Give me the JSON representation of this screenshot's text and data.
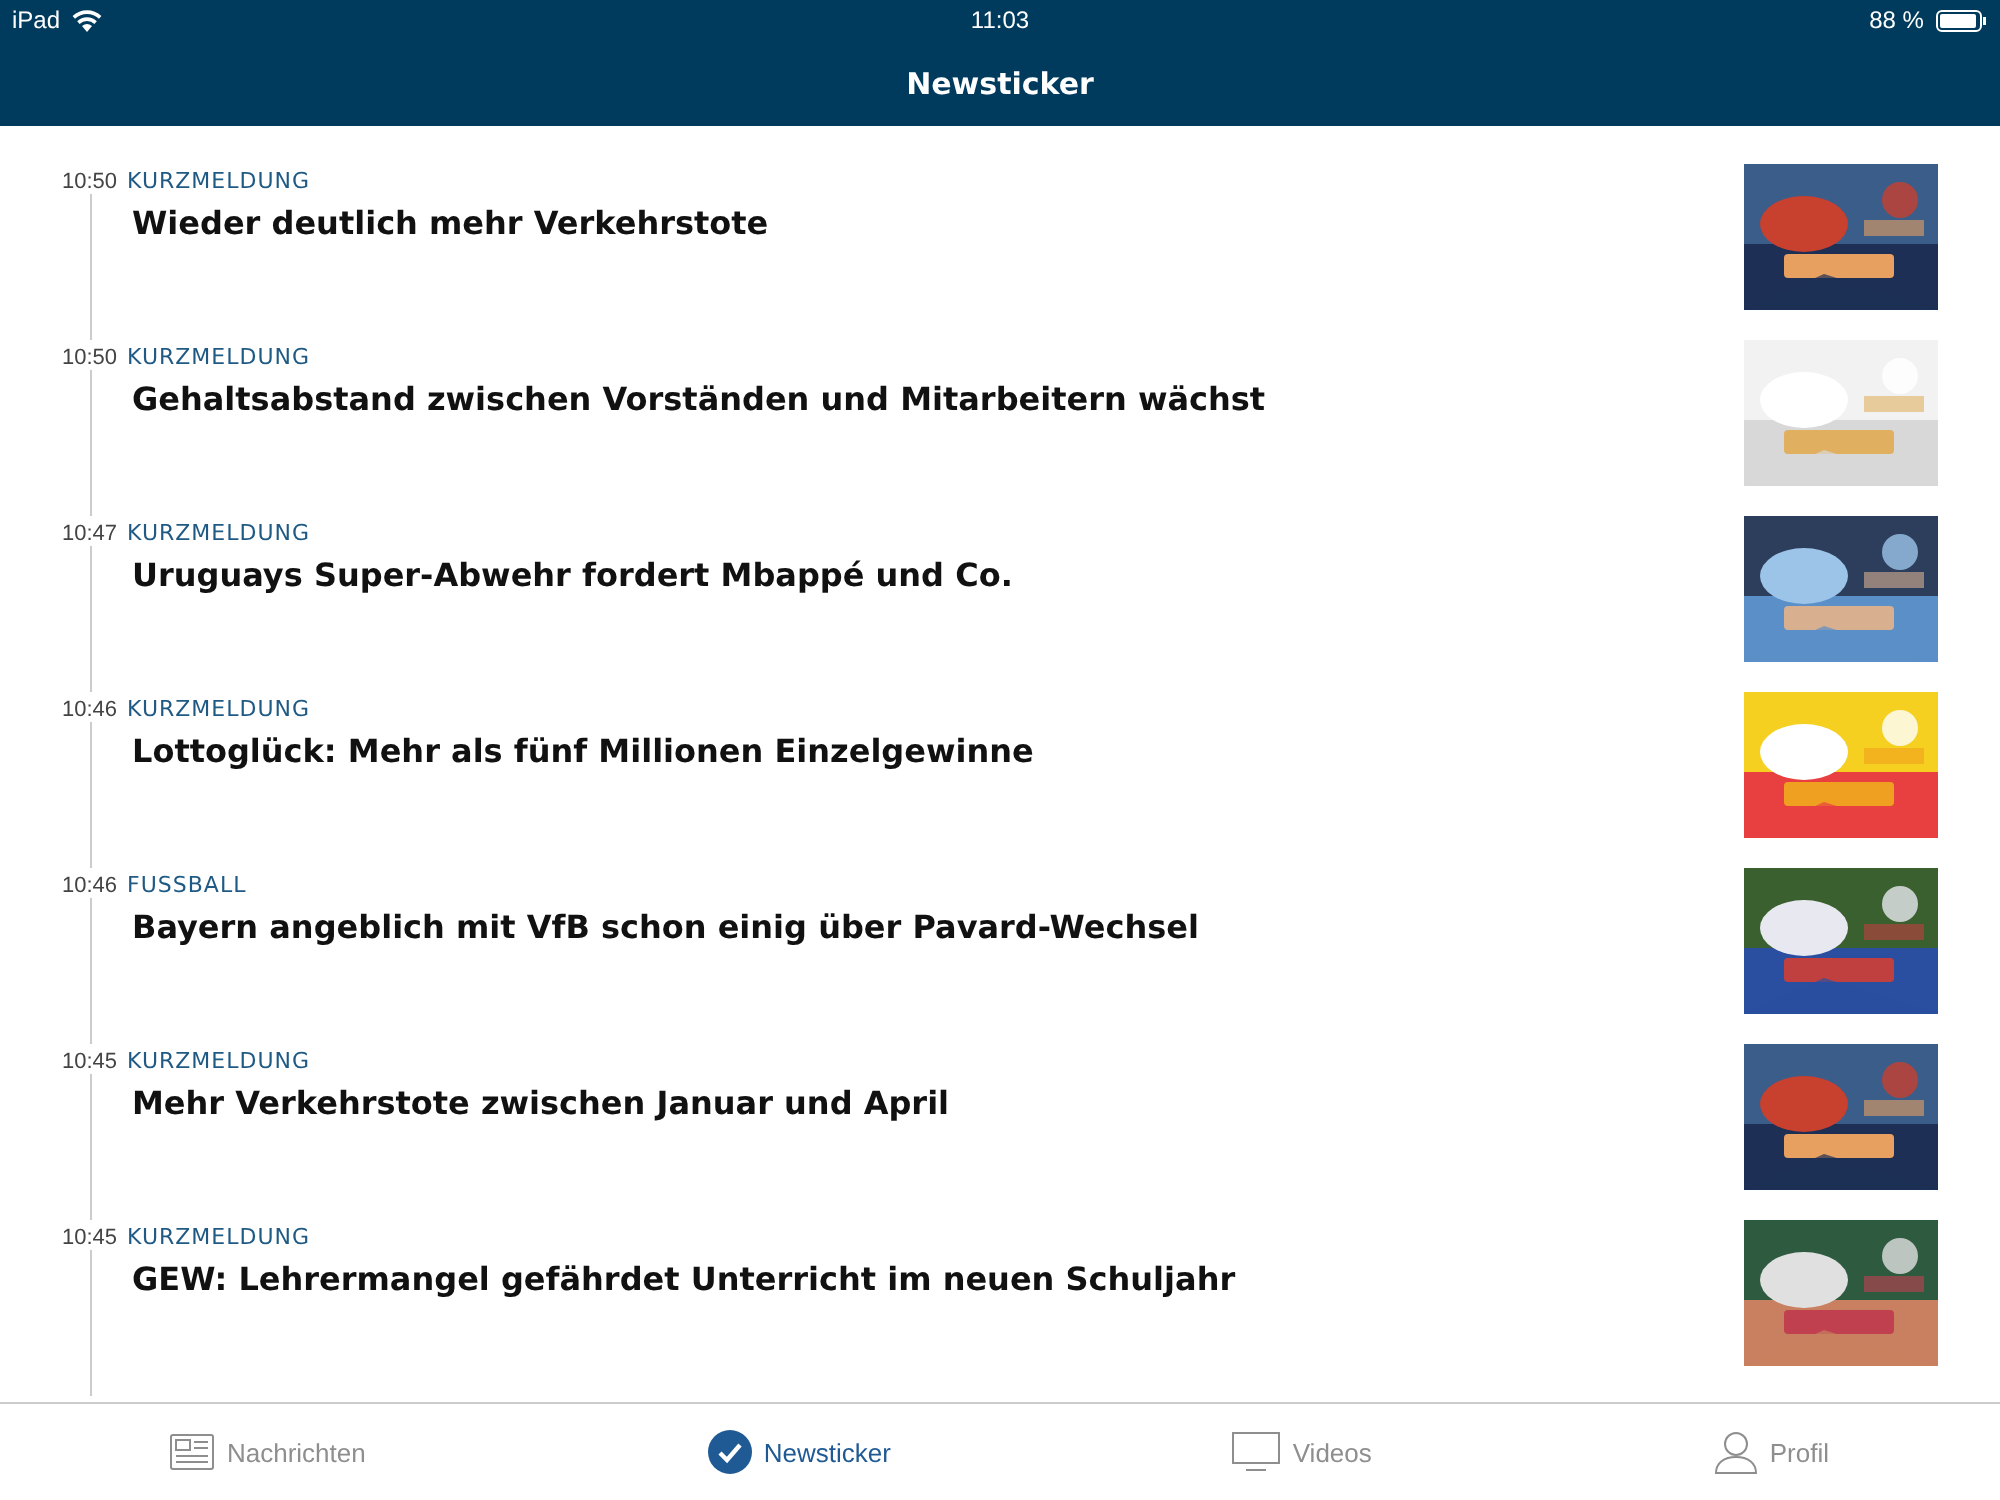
{
  "status_bar": {
    "device": "iPad",
    "time": "11:03",
    "battery": "88 %"
  },
  "nav": {
    "title": "Newsticker"
  },
  "items": [
    {
      "time": "10:50",
      "category": "KURZMELDUNG",
      "title": "Wieder deutlich mehr Verkehrstote"
    },
    {
      "time": "10:50",
      "category": "KURZMELDUNG",
      "title": "Gehaltsabstand zwischen Vorständen und Mitarbeitern wächst"
    },
    {
      "time": "10:47",
      "category": "KURZMELDUNG",
      "title": "Uruguays Super-Abwehr fordert Mbappé und Co."
    },
    {
      "time": "10:46",
      "category": "KURZMELDUNG",
      "title": "Lottoglück: Mehr als fünf Millionen Einzelgewinne"
    },
    {
      "time": "10:46",
      "category": "FUSSBALL",
      "title": "Bayern angeblich mit VfB schon einig über Pavard-Wechsel"
    },
    {
      "time": "10:45",
      "category": "KURZMELDUNG",
      "title": "Mehr Verkehrstote zwischen Januar und April"
    },
    {
      "time": "10:45",
      "category": "KURZMELDUNG",
      "title": "GEW: Lehrermangel gefährdet Unterricht im neuen Schuljahr"
    }
  ],
  "tabs": [
    {
      "label": "Nachrichten",
      "kind": "news",
      "selected": false
    },
    {
      "label": "Newsticker",
      "kind": "ticker",
      "selected": true
    },
    {
      "label": "Videos",
      "kind": "video",
      "selected": false
    },
    {
      "label": "Profil",
      "kind": "profile",
      "selected": false
    }
  ]
}
